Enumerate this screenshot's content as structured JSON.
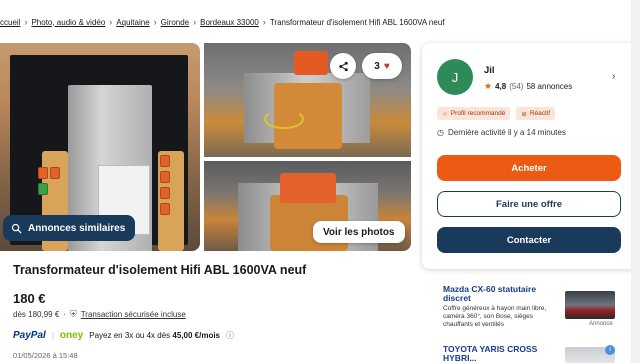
{
  "breadcrumb": {
    "items": [
      "ccueil",
      "Photo, audio & vidéo",
      "Aquitaine",
      "Gironde",
      "Bordeaux 33000"
    ],
    "current": "Transformateur d'isolement Hifi ABL 1600VA neuf"
  },
  "gallery": {
    "favorite_count": "3",
    "similar_label": "Annonces similaires",
    "see_photos_label": "Voir les photos"
  },
  "product": {
    "title": "Transformateur d'isolement Hifi ABL 1600VA neuf",
    "price": "180 €",
    "price_from": "dès 180,99 €",
    "secure_label": "Transaction sécurisée incluse",
    "paypal_label": "PayPal",
    "oney_label": "oney",
    "installments_prefix": "Payez en 3x ou 4x dès",
    "installments_amount": "45,00 €/mois",
    "date": "01/05/2026 à 15:48"
  },
  "seller": {
    "avatar_letter": "J",
    "name": "Jil",
    "rating": "4,8",
    "rating_count": "(54)",
    "listings": "58 annonces",
    "badges": [
      "Profil recommandé",
      "Réactif"
    ],
    "last_activity": "Dernière activité il y a 14 minutes",
    "buy_label": "Acheter",
    "offer_label": "Faire une offre",
    "contact_label": "Contacter"
  },
  "ads": [
    {
      "title_line1": "Mazda CX-60 statutaire",
      "title_line2": "discret",
      "description": "Coffre généreux à hayon main libre, caméra 360°, son Bose, sièges chauffants et ventilés",
      "tag": "Annonce"
    },
    {
      "title_line1": "TOYOTA YARIS CROSS",
      "title_line2": "HYBRI..."
    }
  ],
  "colors": {
    "accent": "#ec5a13",
    "primary": "#1a3a5c",
    "avatar": "#2e8b57"
  }
}
